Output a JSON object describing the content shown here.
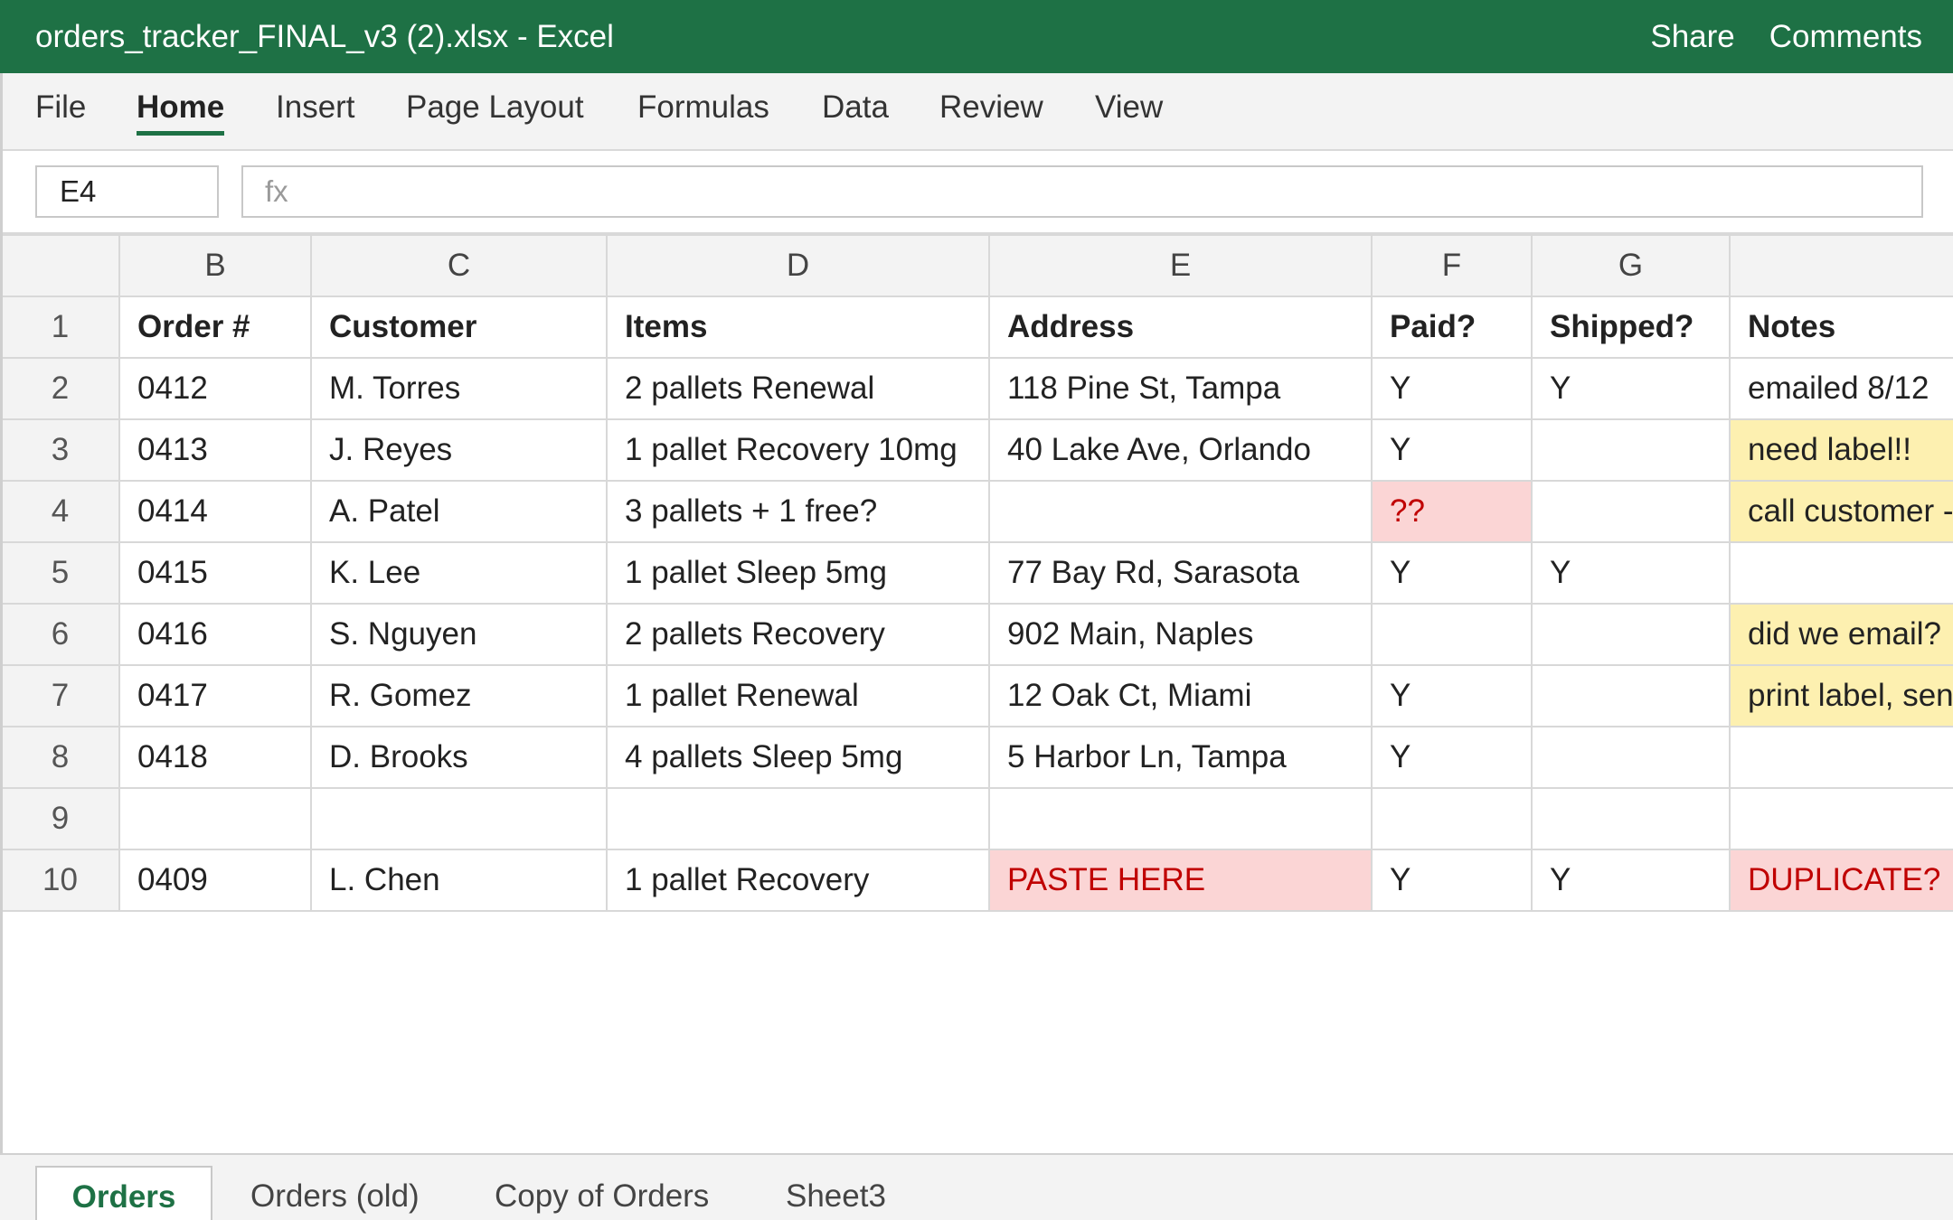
{
  "window": {
    "title": "orders_tracker_FINAL_v3 (2).xlsx - Excel",
    "share_label": "Share",
    "comments_label": "Comments"
  },
  "ribbon": {
    "tabs": [
      "File",
      "Home",
      "Insert",
      "Page Layout",
      "Formulas",
      "Data",
      "Review",
      "View"
    ],
    "active": "Home"
  },
  "formula_bar": {
    "cell_ref": "E4",
    "fx_placeholder": "fx"
  },
  "grid": {
    "column_headers": [
      "B",
      "C",
      "D",
      "E",
      "F",
      "G",
      ""
    ],
    "rows": [
      {
        "num": "1",
        "cells": [
          "Order #",
          "Customer",
          "Items",
          "Address",
          "Paid?",
          "Shipped?",
          "Notes"
        ]
      },
      {
        "num": "2",
        "cells": [
          "0412",
          "M. Torres",
          "2 pallets Renewal",
          "118 Pine St, Tampa",
          "Y",
          "Y",
          "emailed 8/12"
        ]
      },
      {
        "num": "3",
        "cells": [
          "0413",
          "J. Reyes",
          "1 pallet Recovery 10mg",
          "40 Lake Ave, Orlando",
          "Y",
          "",
          "need label!!"
        ]
      },
      {
        "num": "4",
        "cells": [
          "0414",
          "A. Patel",
          "3 pallets + 1 free?",
          "",
          "??",
          "",
          "call customer -"
        ]
      },
      {
        "num": "5",
        "cells": [
          "0415",
          "K. Lee",
          "1 pallet Sleep 5mg",
          "77 Bay Rd, Sarasota",
          "Y",
          "Y",
          ""
        ]
      },
      {
        "num": "6",
        "cells": [
          "0416",
          "S. Nguyen",
          "2 pallets Recovery",
          "902 Main, Naples",
          "",
          "",
          "did we email?"
        ]
      },
      {
        "num": "7",
        "cells": [
          "0417",
          "R. Gomez",
          "1 pallet Renewal",
          "12 Oak Ct, Miami",
          "Y",
          "",
          "print label, send"
        ]
      },
      {
        "num": "8",
        "cells": [
          "0418",
          "D. Brooks",
          "4 pallets Sleep 5mg",
          "5 Harbor Ln, Tampa",
          "Y",
          "",
          ""
        ]
      },
      {
        "num": "9",
        "cells": [
          "",
          "",
          "",
          "",
          "",
          "",
          ""
        ]
      },
      {
        "num": "10",
        "cells": [
          "0409",
          "L. Chen",
          "1 pallet Recovery",
          "PASTE HERE",
          "Y",
          "Y",
          "DUPLICATE?"
        ]
      }
    ],
    "highlight_colors": {
      "red_fill": "#fbd5d5",
      "red_text": "#c00000",
      "yellow_fill": "#fdf0b0"
    }
  },
  "sheets": {
    "tabs": [
      "Orders",
      "Orders (old)",
      "Copy of Orders",
      "Sheet3"
    ],
    "active": "Orders"
  },
  "colors": {
    "brand": "#1e7145"
  }
}
